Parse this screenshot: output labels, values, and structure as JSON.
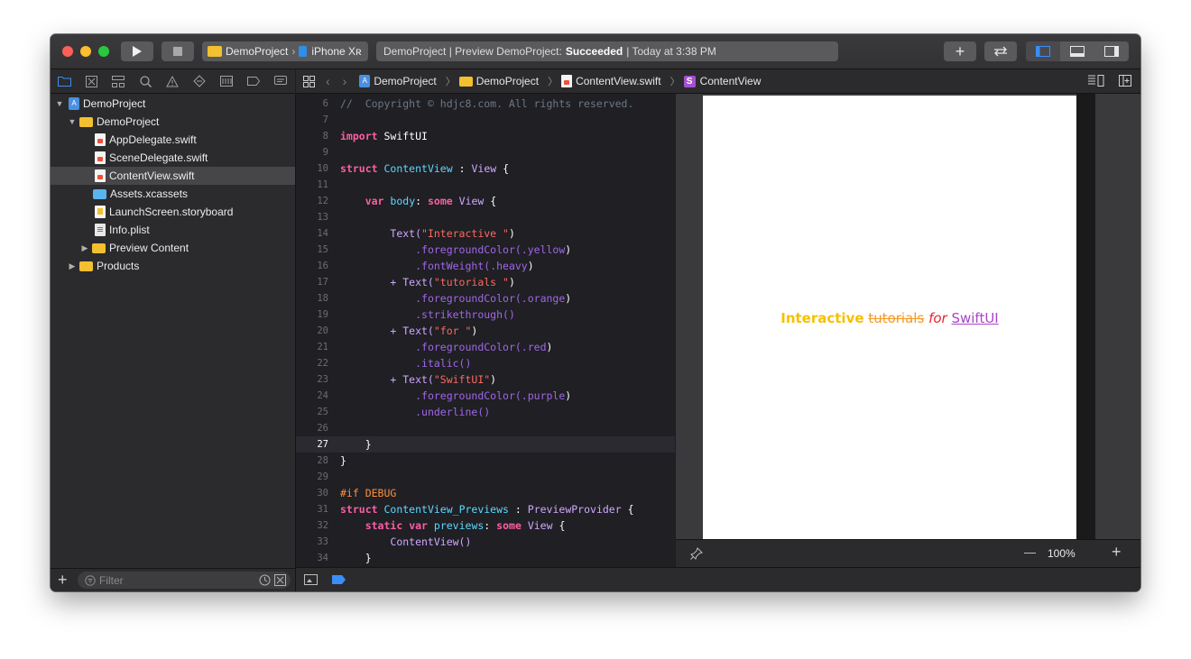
{
  "toolbar": {
    "scheme_project": "DemoProject",
    "scheme_device": "iPhone Xʀ",
    "status_prefix": "DemoProject | Preview DemoProject:",
    "status_result": "Succeeded",
    "status_time": "| Today at 3:38 PM",
    "add_label": "+"
  },
  "navigator": {
    "items": [
      {
        "label": "DemoProject",
        "icon": "project-icon"
      },
      {
        "label": "DemoProject",
        "icon": "folder-icon"
      },
      {
        "label": "AppDelegate.swift",
        "icon": "swift-file-icon"
      },
      {
        "label": "SceneDelegate.swift",
        "icon": "swift-file-icon"
      },
      {
        "label": "ContentView.swift",
        "icon": "swift-file-icon"
      },
      {
        "label": "Assets.xcassets",
        "icon": "assets-folder-icon"
      },
      {
        "label": "LaunchScreen.storyboard",
        "icon": "storyboard-icon"
      },
      {
        "label": "Info.plist",
        "icon": "plist-icon"
      },
      {
        "label": "Preview Content",
        "icon": "folder-icon"
      },
      {
        "label": "Products",
        "icon": "folder-icon"
      }
    ],
    "filter_placeholder": "Filter",
    "add_label": "+"
  },
  "jumpbar": {
    "crumbs": [
      "DemoProject",
      "DemoProject",
      "ContentView.swift",
      "ContentView"
    ],
    "symbol_badge": "S"
  },
  "editor": {
    "line_numbers": [
      "6",
      "7",
      "8",
      "9",
      "10",
      "11",
      "12",
      "13",
      "14",
      "15",
      "16",
      "17",
      "18",
      "19",
      "20",
      "21",
      "22",
      "23",
      "24",
      "25",
      "26",
      "27",
      "28",
      "29",
      "30",
      "31",
      "32",
      "33",
      "34"
    ],
    "current_line": "27",
    "tokens": {
      "copyright": "//  Copyright © hdjc8.com. All rights reserved.",
      "import_kw": "import",
      "import_mod": "SwiftUI",
      "struct_kw": "struct",
      "content_view": "ContentView",
      "colon": ":",
      "view_type": "View",
      "brace_open": "{",
      "brace_close": "}",
      "var_kw": "var",
      "body": "body",
      "some_kw": "some",
      "text_fn": "Text(",
      "str_interactive": "\"Interactive \"",
      "str_tutorials": "\"tutorials \"",
      "str_for": "\"for \"",
      "str_swiftui": "\"SwiftUI\"",
      "paren_close": ")",
      "plus_text": "+ Text(",
      "fg_color": ".foregroundColor(",
      "yellow": ".yellow",
      "orange": ".orange",
      "red": ".red",
      "purple": ".purple",
      "font_weight": ".fontWeight(",
      "heavy": ".heavy",
      "strikethrough": ".strikethrough()",
      "italic": ".italic()",
      "underline": ".underline()",
      "if_debug": "#if DEBUG",
      "previews_struct": "ContentView_Previews",
      "preview_provider": "PreviewProvider",
      "static_kw": "static",
      "previews": "previews",
      "content_view_call": "ContentView()"
    }
  },
  "preview": {
    "words": [
      "Interactive",
      "tutorials",
      "for",
      "SwiftUI"
    ],
    "colors": {
      "yellow": "#f7c000",
      "orange": "#f59a23",
      "red": "#e8242e",
      "purple": "#a945c8"
    }
  },
  "canvas": {
    "zoom": "100%",
    "zoom_out": "—",
    "zoom_in": "+"
  },
  "colors": {
    "accent": "#3a8ef6",
    "keyword": "#fc5fa3",
    "type": "#5dd8ff",
    "string": "#fc6a5d"
  }
}
